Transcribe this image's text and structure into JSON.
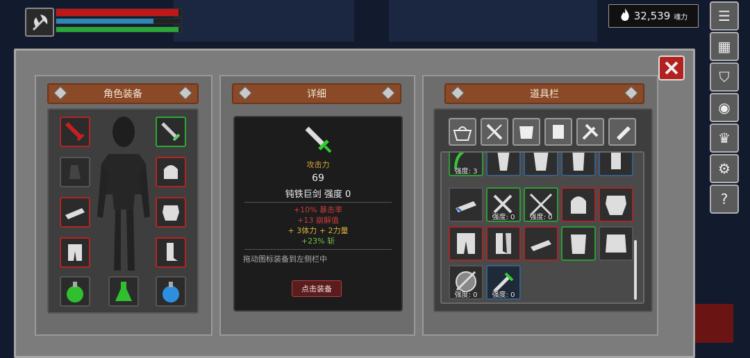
{
  "hud": {
    "weapon_icon": "axe-icon",
    "health_fraction": 0.98,
    "mana_fraction": 0.78,
    "stamina_fraction": 0.98
  },
  "souls": {
    "icon": "flame-icon",
    "amount": "32,539",
    "unit": "魂力"
  },
  "side_menu": [
    {
      "icon": "menu-icon"
    },
    {
      "icon": "map-icon"
    },
    {
      "icon": "armor-icon"
    },
    {
      "icon": "skills-icon"
    },
    {
      "icon": "crown-icon"
    },
    {
      "icon": "settings-icon"
    },
    {
      "icon": "help-icon",
      "label": "?"
    }
  ],
  "close_icon": "close-icon",
  "panels": {
    "equipment": {
      "title": "角色装备"
    },
    "detail": {
      "title": "详细"
    },
    "inventory": {
      "title": "道具栏"
    }
  },
  "equipment_slots": [
    {
      "name": "weapon-left",
      "icon": "red-sword-icon"
    },
    {
      "name": "weapon-right",
      "icon": "green-sword-icon"
    },
    {
      "name": "trinket",
      "icon": "vial-icon"
    },
    {
      "name": "helmet",
      "icon": "helmet-icon"
    },
    {
      "name": "gloves",
      "icon": "glove-icon"
    },
    {
      "name": "chest",
      "icon": "chest-armor-icon"
    },
    {
      "name": "legs",
      "icon": "leg-armor-icon"
    },
    {
      "name": "boots",
      "icon": "boots-icon"
    },
    {
      "name": "potion-green",
      "icon": "green-potion-icon"
    },
    {
      "name": "potion-flask",
      "icon": "flask-icon"
    },
    {
      "name": "potion-blue",
      "icon": "blue-potion-icon"
    }
  ],
  "detail": {
    "item_icon": "green-sword-icon",
    "stat_label": "攻击力",
    "stat_value": "69",
    "item_name": "钝铁巨剑 强度 0",
    "bonuses": [
      "+10% 暴击率",
      "+13 崩解值",
      "+ 3体力  + 2力量",
      "+23% 斩"
    ],
    "hint": "拖动图标装备到左侧栏中",
    "equip_button": "点击装备"
  },
  "inventory_filters": [
    {
      "icon": "basket-icon"
    },
    {
      "icon": "weapon-filter-icon"
    },
    {
      "icon": "armor-filter-icon"
    },
    {
      "icon": "chest-filter-icon"
    },
    {
      "icon": "tools-filter-icon"
    },
    {
      "icon": "scroll-filter-icon"
    }
  ],
  "inventory_items": [
    {
      "icon": "bow-icon",
      "label": "强度: 3"
    },
    {
      "icon": "glove-icon",
      "label": ""
    },
    {
      "icon": "chest-armor-icon",
      "label": ""
    },
    {
      "icon": "leg-armor-icon",
      "label": ""
    },
    {
      "icon": "boots-icon",
      "label": ""
    },
    {
      "icon": "glove-icon",
      "label": ""
    },
    {
      "icon": "crossed-daggers-icon",
      "label": "强度: 0"
    },
    {
      "icon": "crossed-swords-icon",
      "label": "强度: 0"
    },
    {
      "icon": "helmet-icon",
      "label": ""
    },
    {
      "icon": "chest-armor-icon",
      "label": ""
    },
    {
      "icon": "leg-armor-icon",
      "label": ""
    },
    {
      "icon": "boots-icon",
      "label": ""
    },
    {
      "icon": "glove-icon",
      "label": ""
    },
    {
      "icon": "belt-icon",
      "label": ""
    },
    {
      "icon": "skirt-icon",
      "label": ""
    },
    {
      "icon": "shield-sword-icon",
      "label": "强度: 0"
    },
    {
      "icon": "green-sword-icon",
      "label": "强度: 0"
    }
  ],
  "colors": {
    "accent_red": "#b32525",
    "accent_green": "#2da836",
    "banner": "#8a4a28"
  }
}
